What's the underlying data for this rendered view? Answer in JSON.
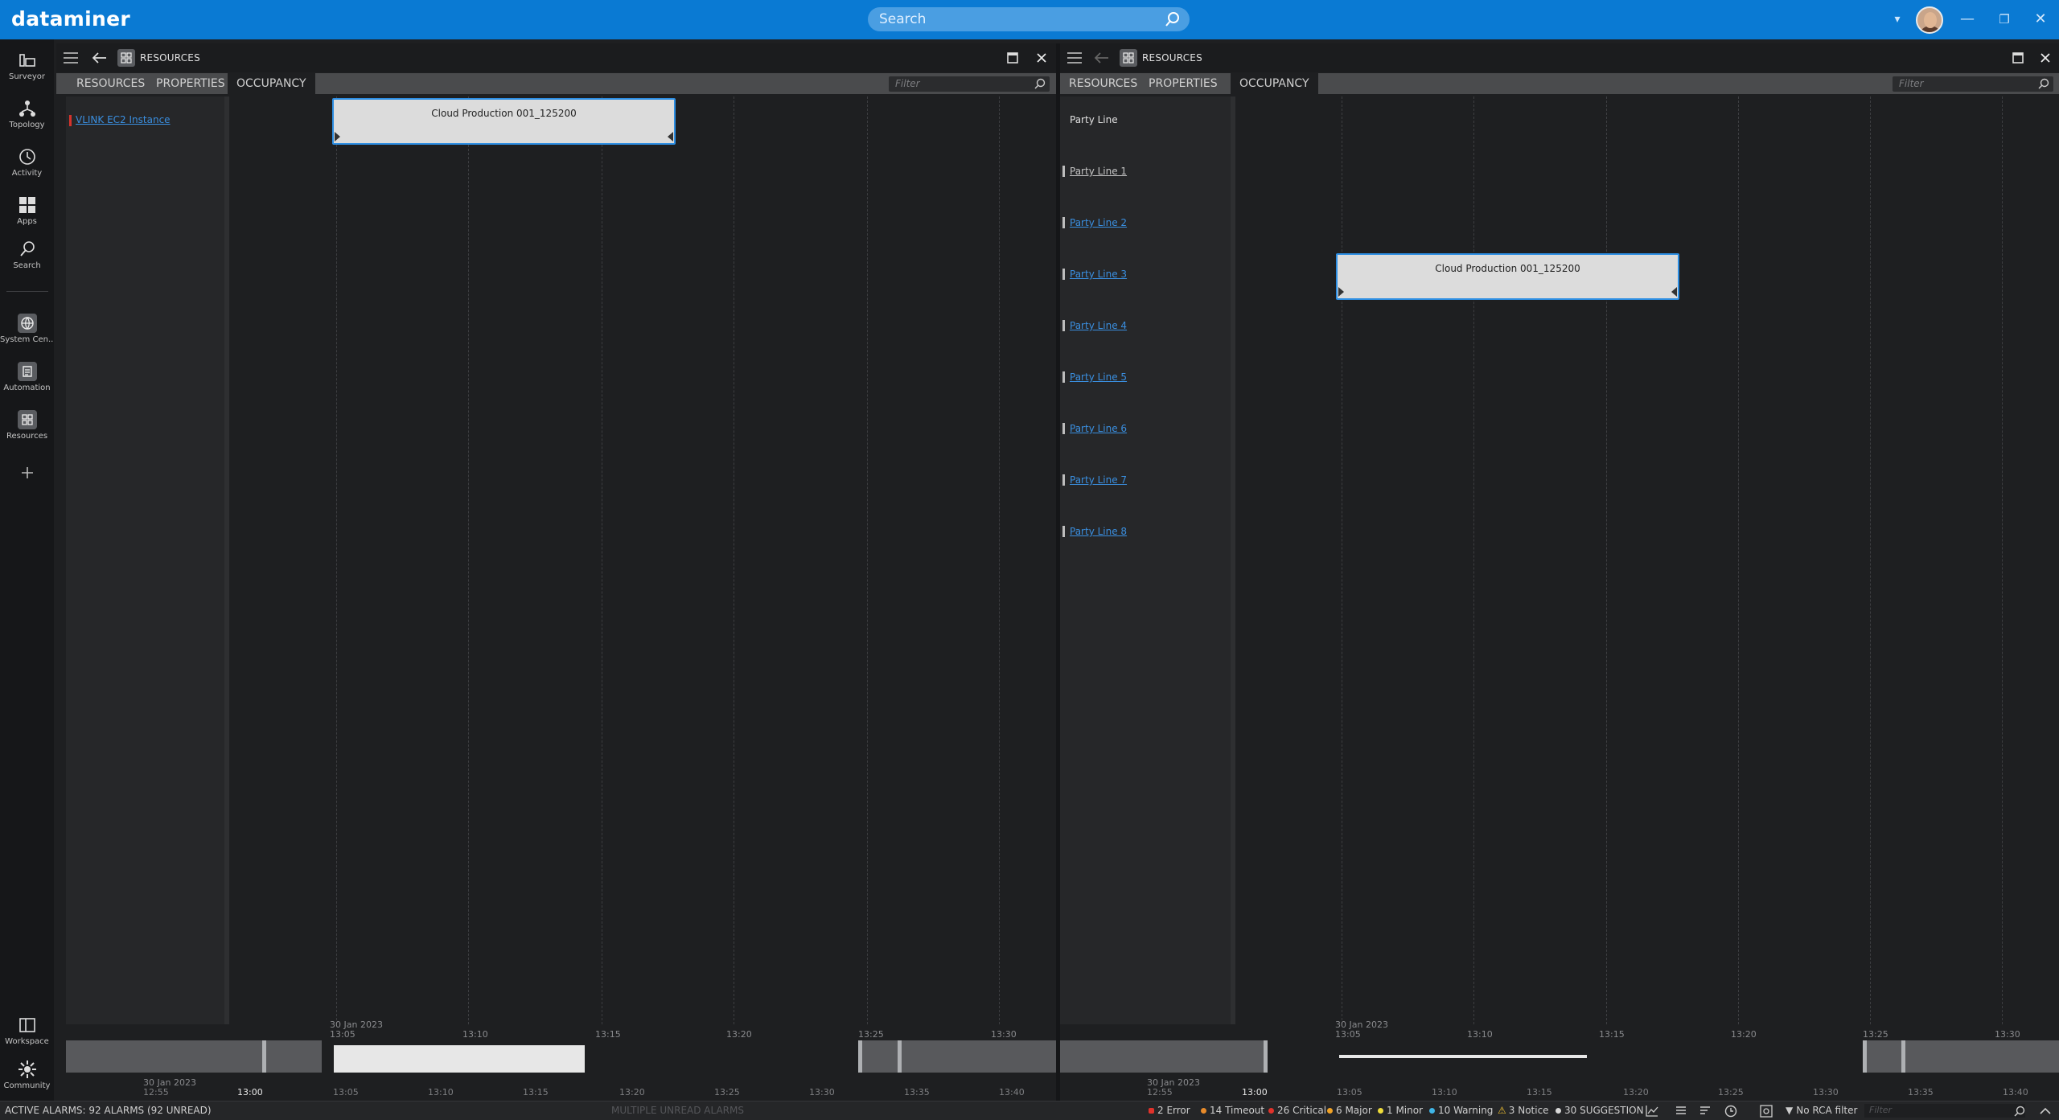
{
  "app": {
    "brand": "dataminer",
    "search_placeholder": "Search"
  },
  "rail": {
    "items": [
      {
        "label": "Surveyor",
        "icon": "surveyor-icon"
      },
      {
        "label": "Topology",
        "icon": "topology-icon"
      },
      {
        "label": "Activity",
        "icon": "activity-icon"
      },
      {
        "label": "Apps",
        "icon": "apps-icon"
      },
      {
        "label": "Search",
        "icon": "search-icon"
      },
      {
        "label": "System Cen...",
        "icon": "system-center-icon"
      },
      {
        "label": "Automation",
        "icon": "automation-icon"
      },
      {
        "label": "Resources",
        "icon": "resources-icon"
      }
    ],
    "bottom": [
      {
        "label": "Workspace",
        "icon": "workspace-icon"
      },
      {
        "label": "Community",
        "icon": "community-icon"
      }
    ]
  },
  "left_panel": {
    "title": "RESOURCES",
    "tabs": [
      "RESOURCES",
      "PROPERTIES",
      "OCCUPANCY"
    ],
    "active_tab": "OCCUPANCY",
    "filter_placeholder": "Filter",
    "resources": [
      {
        "name": "VLINK EC2 Instance"
      }
    ],
    "booking": {
      "label": "Cloud Production 001_125200"
    },
    "timeline": {
      "date": "30 Jan 2023",
      "top_ticks": [
        "13:05",
        "13:10",
        "13:15",
        "13:20",
        "13:25",
        "13:30"
      ],
      "bottom_date": "30 Jan 2023",
      "bottom_ticks": [
        "12:55",
        "13:00",
        "13:05",
        "13:10",
        "13:15",
        "13:20",
        "13:25",
        "13:30",
        "13:35",
        "13:40"
      ]
    }
  },
  "right_panel": {
    "title": "RESOURCES",
    "tabs": [
      "RESOURCES",
      "PROPERTIES",
      "OCCUPANCY"
    ],
    "active_tab": "OCCUPANCY",
    "filter_placeholder": "Filter",
    "group": "Party Line",
    "resources": [
      {
        "name": "Party Line 1"
      },
      {
        "name": "Party Line 2"
      },
      {
        "name": "Party Line 3"
      },
      {
        "name": "Party Line 4"
      },
      {
        "name": "Party Line 5"
      },
      {
        "name": "Party Line 6"
      },
      {
        "name": "Party Line 7"
      },
      {
        "name": "Party Line 8"
      }
    ],
    "booking": {
      "label": "Cloud Production 001_125200"
    },
    "timeline": {
      "date": "30 Jan 2023",
      "top_ticks": [
        "13:05",
        "13:10",
        "13:15",
        "13:20",
        "13:25",
        "13:30"
      ],
      "bottom_date": "30 Jan 2023",
      "bottom_ticks": [
        "12:55",
        "13:00",
        "13:05",
        "13:10",
        "13:15",
        "13:20",
        "13:25",
        "13:30",
        "13:35",
        "13:40"
      ]
    }
  },
  "alarm_bar": {
    "active": "ACTIVE ALARMS: 92 ALARMS (92 UNREAD)",
    "middle": "MULTIPLE UNREAD ALARMS",
    "counts": [
      {
        "label": "2 Error",
        "color": "#e0322b"
      },
      {
        "label": "14 Timeout",
        "color": "#e98b2a"
      },
      {
        "label": "26 Critical",
        "color": "#e0322b"
      },
      {
        "label": "6 Major",
        "color": "#f0a226"
      },
      {
        "label": "1 Minor",
        "color": "#eedc3a"
      },
      {
        "label": "10 Warning",
        "color": "#3fb5e6"
      },
      {
        "label": "3 Notice",
        "color": "#f2c230"
      },
      {
        "label": "30 SUGGESTION",
        "color": "#d8d8d8"
      }
    ],
    "rca": "No RCA filter",
    "filter_placeholder": "Filter"
  }
}
